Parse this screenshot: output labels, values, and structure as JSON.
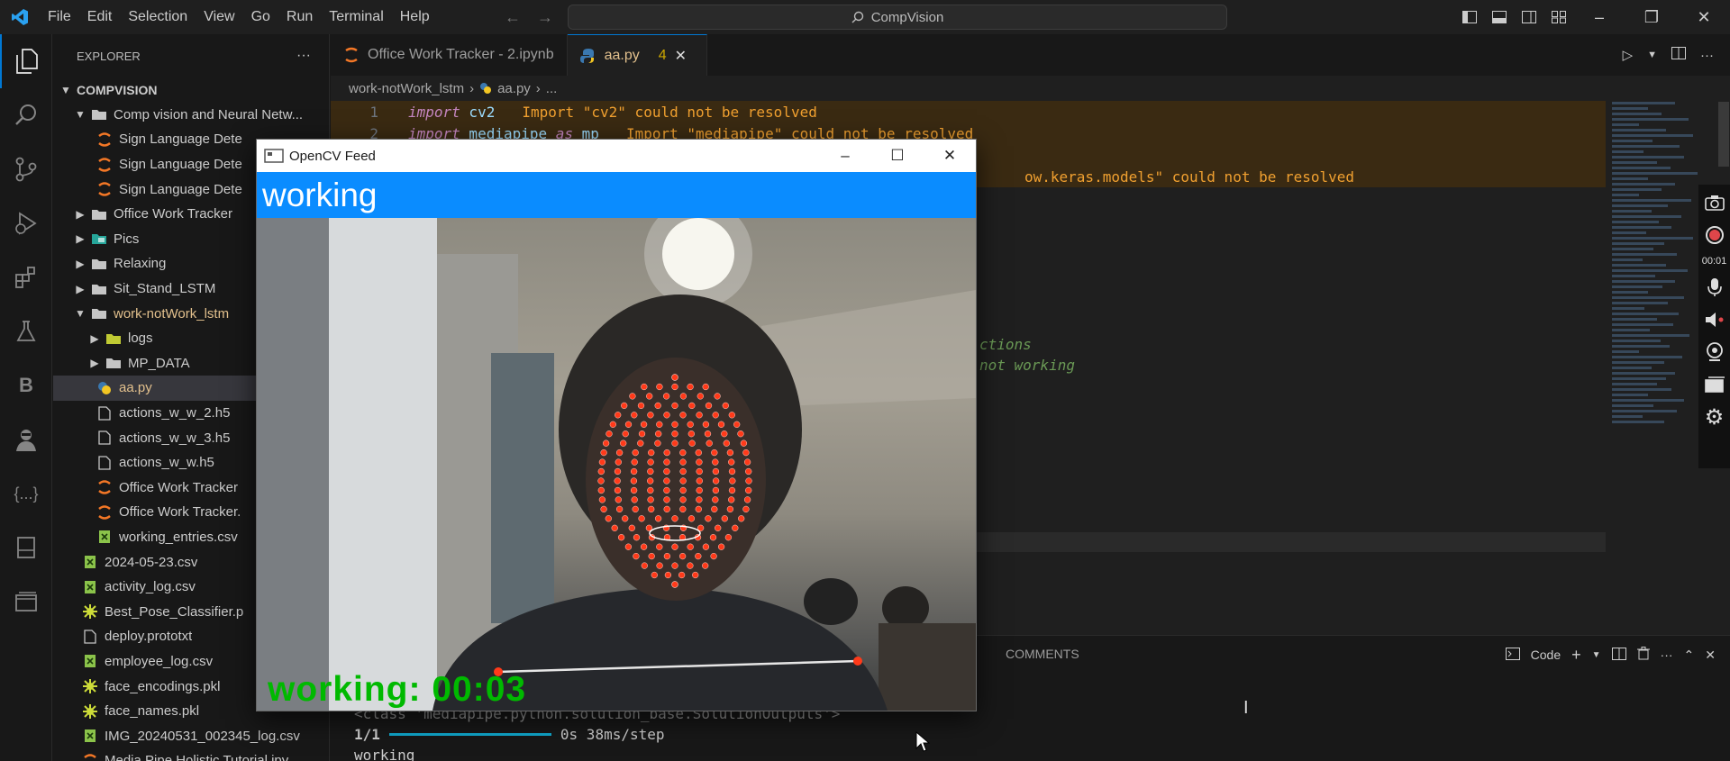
{
  "menu": [
    "File",
    "Edit",
    "Selection",
    "View",
    "Go",
    "Run",
    "Terminal",
    "Help"
  ],
  "search": {
    "label": "CompVision"
  },
  "sidebar": {
    "title": "EXPLORER",
    "root": "COMPVISION",
    "items": [
      {
        "label": "Comp vision and Neural Netw...",
        "type": "folder",
        "open": true,
        "depth": 1
      },
      {
        "label": "Sign Language Dete",
        "type": "ipynb",
        "depth": 2
      },
      {
        "label": "Sign Language Dete",
        "type": "ipynb",
        "depth": 2
      },
      {
        "label": "Sign Language Dete",
        "type": "ipynb",
        "depth": 2
      },
      {
        "label": "Office Work Tracker",
        "type": "folder",
        "open": false,
        "depth": 1
      },
      {
        "label": "Pics",
        "type": "folder-pics",
        "open": false,
        "depth": 1
      },
      {
        "label": "Relaxing",
        "type": "folder",
        "open": false,
        "depth": 1
      },
      {
        "label": "Sit_Stand_LSTM",
        "type": "folder",
        "open": false,
        "depth": 1
      },
      {
        "label": "work-notWork_lstm",
        "type": "folder",
        "open": true,
        "depth": 1,
        "modified": true
      },
      {
        "label": "logs",
        "type": "folder-logs",
        "open": false,
        "depth": 2
      },
      {
        "label": "MP_DATA",
        "type": "folder",
        "open": false,
        "depth": 2
      },
      {
        "label": "aa.py",
        "type": "py",
        "depth": 2,
        "selected": true,
        "modified": true
      },
      {
        "label": "actions_w_w_2.h5",
        "type": "file",
        "depth": 2
      },
      {
        "label": "actions_w_w_3.h5",
        "type": "file",
        "depth": 2
      },
      {
        "label": "actions_w_w.h5",
        "type": "file",
        "depth": 2
      },
      {
        "label": "Office Work Tracker",
        "type": "ipynb",
        "depth": 2
      },
      {
        "label": "Office Work Tracker.",
        "type": "ipynb",
        "depth": 2
      },
      {
        "label": "working_entries.csv",
        "type": "csv",
        "depth": 2
      },
      {
        "label": "2024-05-23.csv",
        "type": "csv",
        "depth": 1
      },
      {
        "label": "activity_log.csv",
        "type": "csv",
        "depth": 1
      },
      {
        "label": "Best_Pose_Classifier.p",
        "type": "pkl",
        "depth": 1
      },
      {
        "label": "deploy.prototxt",
        "type": "file",
        "depth": 1
      },
      {
        "label": "employee_log.csv",
        "type": "csv",
        "depth": 1
      },
      {
        "label": "face_encodings.pkl",
        "type": "pkl",
        "depth": 1
      },
      {
        "label": "face_names.pkl",
        "type": "pkl",
        "depth": 1
      },
      {
        "label": "IMG_20240531_002345_log.csv",
        "type": "csv",
        "depth": 1
      },
      {
        "label": "Media Pipe Holistic Tutorial.ipy",
        "type": "ipynb",
        "depth": 1
      }
    ]
  },
  "tabs": [
    {
      "label": "Office Work Tracker - 2.ipynb",
      "icon": "jupyter-icon",
      "active": false
    },
    {
      "label": "aa.py",
      "icon": "python-icon",
      "active": true,
      "badge": "4"
    }
  ],
  "breadcrumb": [
    "work-notWork_lstm",
    "aa.py",
    "..."
  ],
  "code": [
    {
      "n": "1",
      "kw": "import",
      "rest": " cv2",
      "diag": "Import \"cv2\" could not be resolved",
      "warn": true
    },
    {
      "n": "2",
      "kw": "import",
      "rest": " mediapipe ",
      "kw2": "as",
      "rest2": " mp",
      "diag": "Import \"mediapipe\" could not be resolved",
      "warn": true
    },
    {
      "n": "",
      "kw": "",
      "rest": "",
      "diag": "",
      "warn": true
    },
    {
      "n": "",
      "kw": "",
      "rest": "",
      "diag": "ow.keras.models\" could not be resolved",
      "warn": true
    }
  ],
  "comments": [
    "ctions",
    "not working"
  ],
  "panel": {
    "tabs": [
      "COMMENTS"
    ],
    "code_label": "Code",
    "terminal": [
      "<class 'mediapipe.python.solution_base.SolutionOutputs'>",
      "1/1",
      "0s 38ms/step",
      "working"
    ]
  },
  "recorder": {
    "time": "00:01"
  },
  "cv": {
    "title": "OpenCV Feed",
    "banner": "working",
    "overlay": "working: 00:03",
    "accent": "#0a8cff",
    "overlay_color": "#00b900",
    "landmark_color": "#ff3a1a"
  },
  "colors": {
    "accent": "#0078d4",
    "warning": "#cca700",
    "modified": "#e2c08d"
  }
}
